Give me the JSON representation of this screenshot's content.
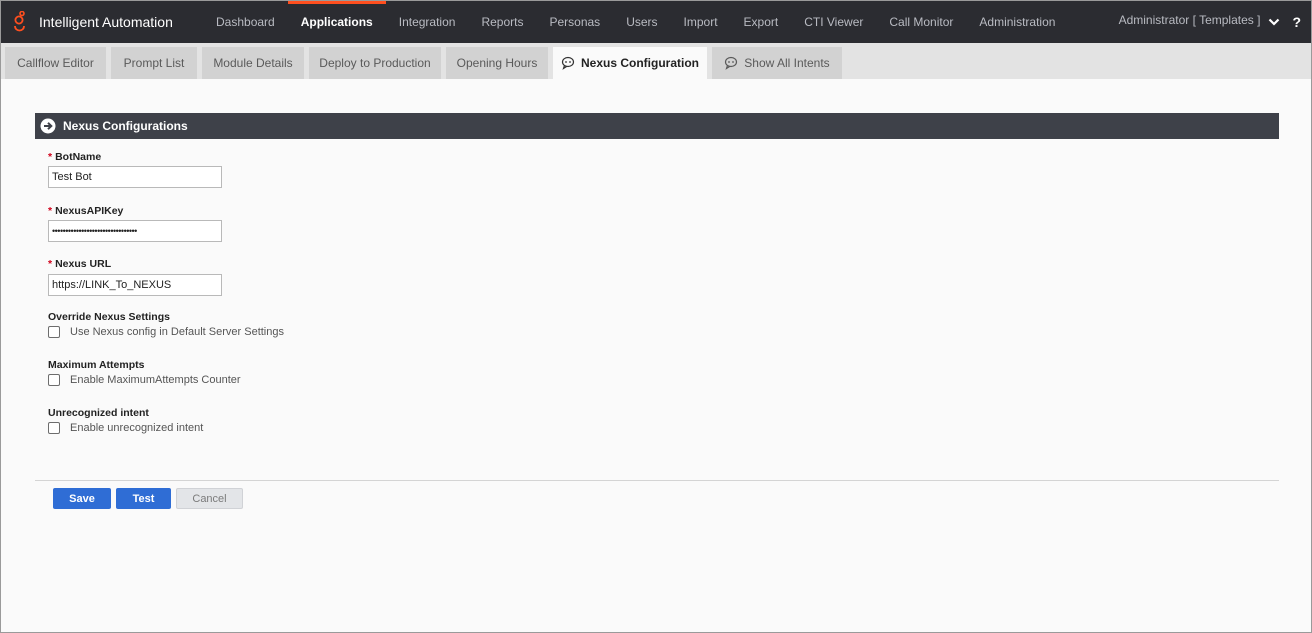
{
  "app": {
    "name": "Intelligent Automation",
    "logo_icon": "genesys-logo-icon",
    "accent_color": "#ff4f1f"
  },
  "nav": {
    "items": [
      {
        "label": "Dashboard",
        "active": false
      },
      {
        "label": "Applications",
        "active": true
      },
      {
        "label": "Integration",
        "active": false
      },
      {
        "label": "Reports",
        "active": false
      },
      {
        "label": "Personas",
        "active": false
      },
      {
        "label": "Users",
        "active": false
      },
      {
        "label": "Import",
        "active": false
      },
      {
        "label": "Export",
        "active": false
      },
      {
        "label": "CTI Viewer",
        "active": false
      },
      {
        "label": "Call Monitor",
        "active": false
      },
      {
        "label": "Administration",
        "active": false
      }
    ]
  },
  "user": {
    "label": "Administrator [ Templates ]",
    "menu_icon": "chevron-down-icon",
    "help": "?"
  },
  "tabs": [
    {
      "label": "Callflow Editor",
      "active": false
    },
    {
      "label": "Prompt List",
      "active": false
    },
    {
      "label": "Module Details",
      "active": false
    },
    {
      "label": "Deploy to Production",
      "active": false
    },
    {
      "label": "Opening Hours",
      "active": false
    },
    {
      "label": "Nexus Configuration",
      "active": true,
      "icon": "chat-bot-icon"
    },
    {
      "label": "Show All Intents",
      "active": false,
      "icon": "chat-bot-icon"
    }
  ],
  "section": {
    "title": "Nexus Configurations",
    "icon": "arrow-circle-right-icon"
  },
  "form": {
    "required_marker": "*",
    "bot_name": {
      "label": "BotName",
      "value": "Test Bot"
    },
    "api_key": {
      "label": "NexusAPIKey",
      "value": "••••••••••••••••••••••••••••••••"
    },
    "nexus_url": {
      "label": "Nexus URL",
      "value": "https://LINK_To_NEXUS"
    },
    "override": {
      "title": "Override Nexus Settings",
      "checkbox_label": "Use Nexus config in Default Server Settings",
      "checked": false
    },
    "max_attempts": {
      "title": "Maximum Attempts",
      "checkbox_label": "Enable MaximumAttempts Counter",
      "checked": false
    },
    "unrecognized": {
      "title": "Unrecognized intent",
      "checkbox_label": "Enable unrecognized intent",
      "checked": false
    }
  },
  "buttons": {
    "save": "Save",
    "test": "Test",
    "cancel": "Cancel"
  }
}
